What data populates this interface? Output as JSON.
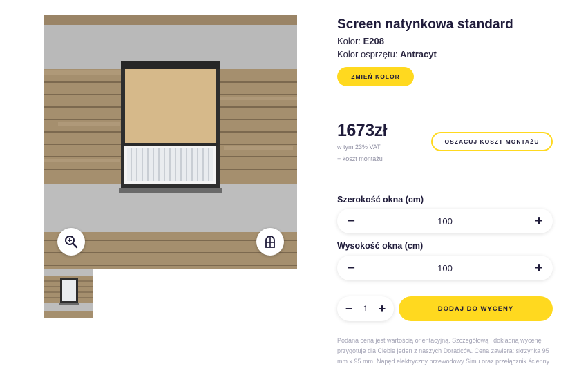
{
  "product": {
    "title": "Screen natynkowa standard",
    "color_label": "Kolor: ",
    "color_value": "E208",
    "fitting_label": "Kolor osprzętu: ",
    "fitting_value": "Antracyt",
    "change_color_button": "ZMIEŃ KOLOR"
  },
  "pricing": {
    "price": "1673zł",
    "vat_note": "w tym 23% VAT",
    "mount_note": "+ koszt montażu",
    "estimate_button": "OSZACUJ KOSZT MONTAŻU"
  },
  "dimensions": {
    "width_label": "Szerokość okna (cm)",
    "width_value": "100",
    "height_label": "Wysokość okna (cm)",
    "height_value": "100",
    "minus_symbol": "−",
    "plus_symbol": "+"
  },
  "cart": {
    "quantity": "1",
    "add_button": "DODAJ DO WYCENY"
  },
  "disclaimer": "Podana cena jest wartością orientacyjną. Szczegółową i dokładną wycenę przygotuje dla Ciebie jeden z naszych Doradców. Cena zawiera: skrzynka 95 mm x 95 mm. Napęd elektryczny przewodowy Simu oraz przełącznik ścienny.",
  "icons": {
    "zoom": "zoom-in-icon",
    "view": "window-view-icon"
  },
  "colors": {
    "accent": "#ffd91f",
    "text_dark": "#1f1b3a",
    "muted": "#a3a3b5",
    "fabric": "#d6b98a",
    "frame": "#2e2e2e"
  }
}
